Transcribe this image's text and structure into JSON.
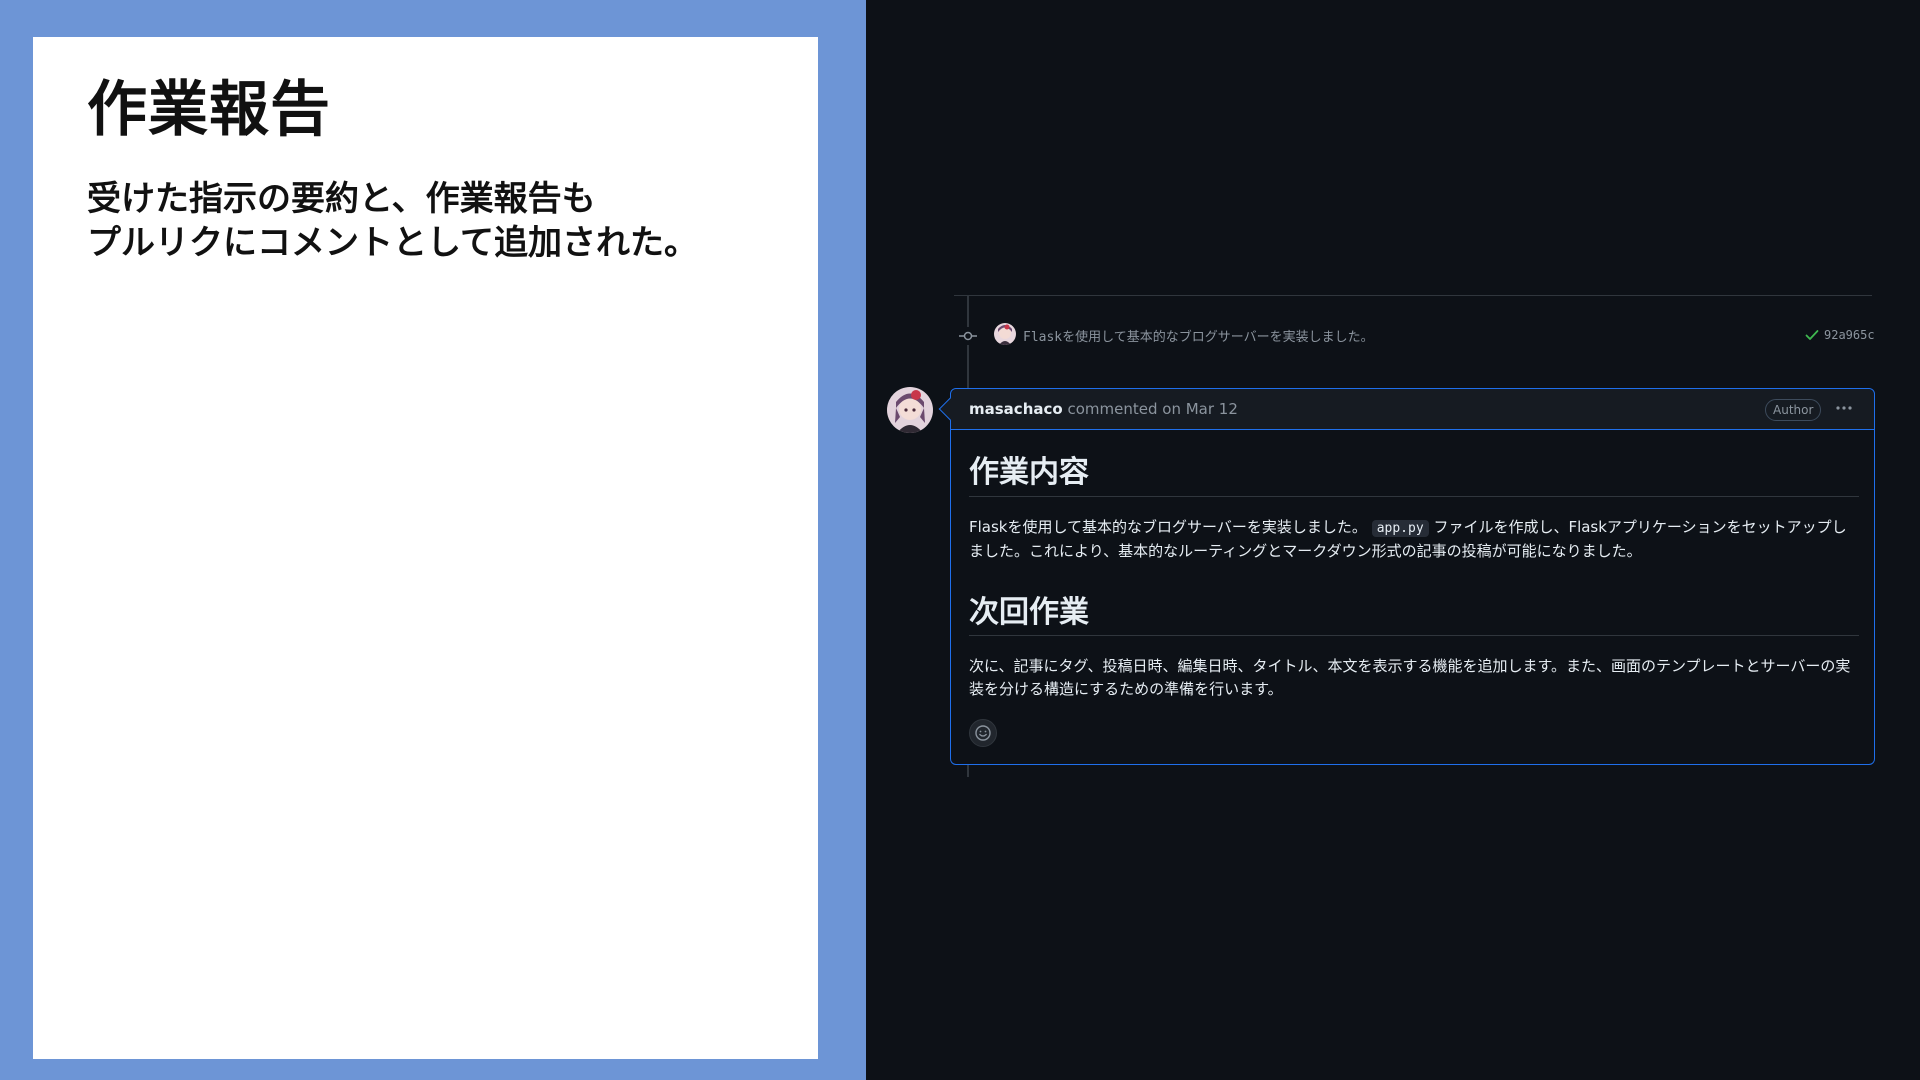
{
  "slide": {
    "title": "作業報告",
    "body_lines": [
      "受けた指示の要約と、作業報告も",
      "プルリクにコメントとして追加された。"
    ]
  },
  "commit": {
    "message_prefix": "Flask",
    "message_rest": "を使用して基本的なブログサーバーを実装しました。",
    "hash": "92a965c",
    "status_icon": "check-icon"
  },
  "comment": {
    "author": "masachaco",
    "action": "commented on Mar 12",
    "badge": "Author",
    "more_icon": "kebab-menu-icon",
    "heading1": "作業内容",
    "para1_before": "Flaskを使用して基本的なブログサーバーを実装しました。",
    "para1_code": "app.py",
    "para1_after": "ファイルを作成し、Flaskアプリケーションをセットアップしました。これにより、基本的なルーティングとマークダウン形式の記事の投稿が可能になりました。",
    "heading2": "次回作業",
    "para2": "次に、記事にタグ、投稿日時、編集日時、タイトル、本文を表示する機能を追加します。また、画面のテンプレートとサーバーの実装を分ける構造にするための準備を行います。",
    "reaction_icon": "smiley-icon"
  },
  "colors": {
    "slide_bg": "#6d95d6",
    "dark_bg": "#0d1117",
    "accent_border": "#1f6feb",
    "success": "#3fb950"
  }
}
